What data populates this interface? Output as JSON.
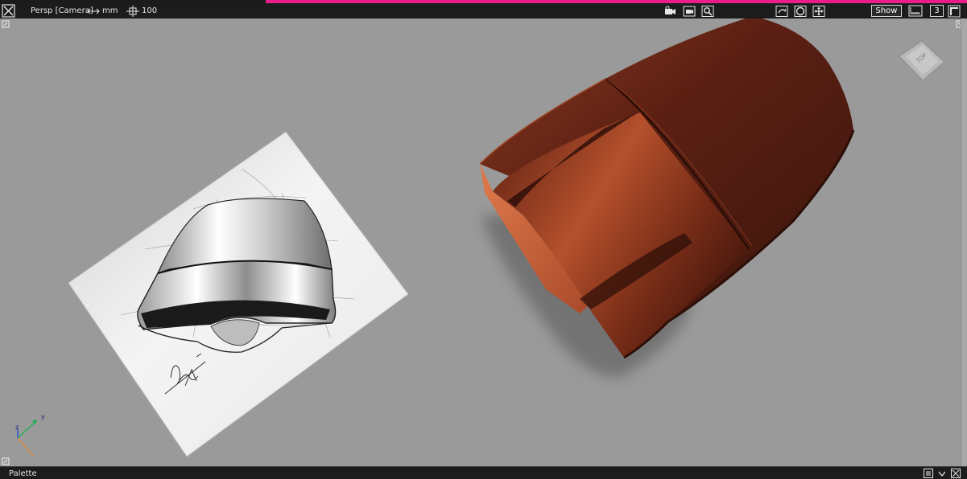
{
  "colors": {
    "accent": "#e81c8c",
    "object": "#6a2418",
    "toolbar_bg": "#1c1c1c",
    "viewport_bg": "#9a9a9a"
  },
  "toolbar": {
    "close_icon": "close-x-icon",
    "view_label": "Persp [Camera]",
    "units_label": "mm",
    "grid_value": "100",
    "show_button": "Show",
    "layout_number": "3"
  },
  "viewport": {
    "axis_labels": {
      "z": "z",
      "y": "y"
    },
    "viewcube_label": "TOP"
  },
  "palette": {
    "label": "Palette"
  }
}
